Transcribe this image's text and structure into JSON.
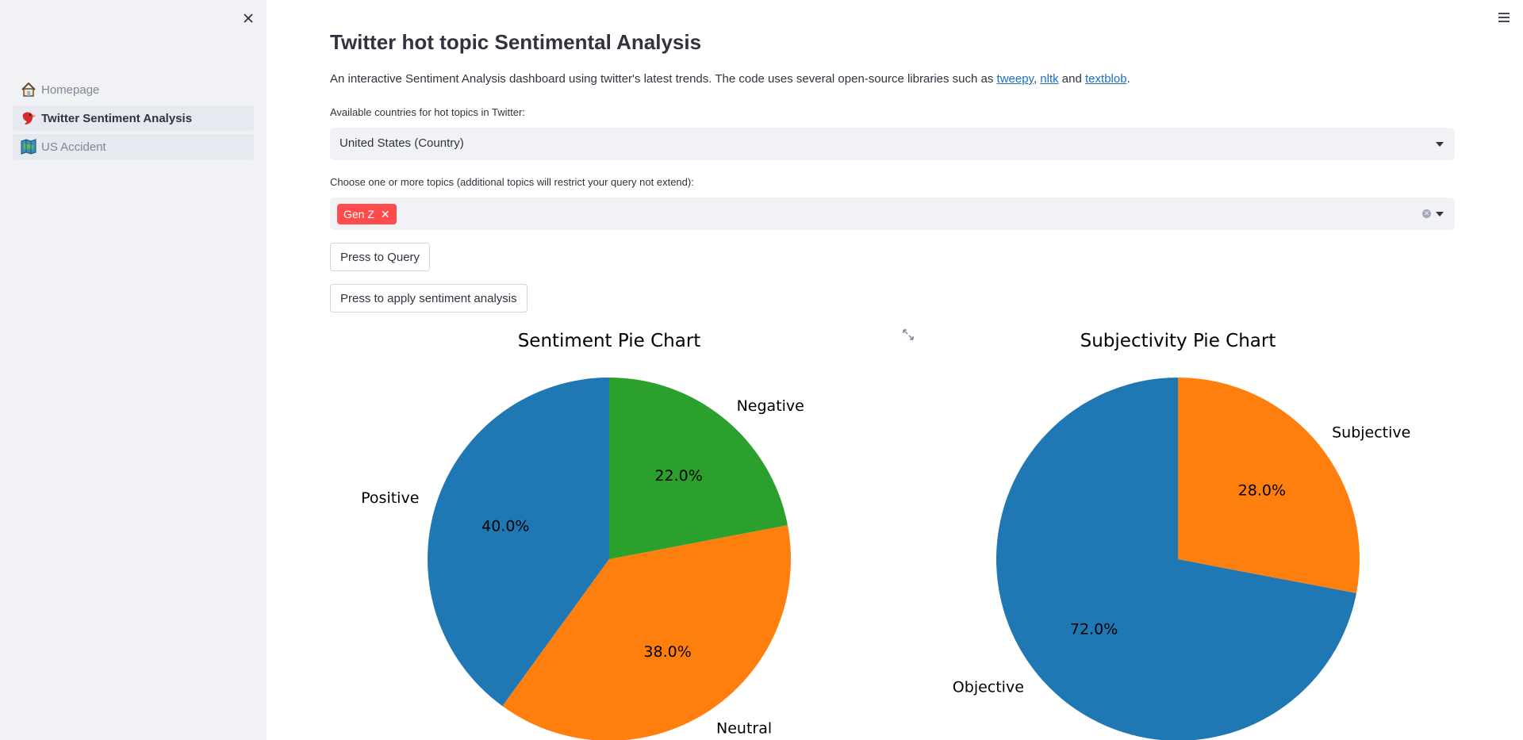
{
  "sidebar": {
    "items": [
      {
        "label": "Homepage",
        "icon": "house-icon",
        "active": false
      },
      {
        "label": "Twitter Sentiment Analysis",
        "icon": "bird-icon",
        "active": true
      },
      {
        "label": "US Accident",
        "icon": "map-icon",
        "active": false
      }
    ]
  },
  "main": {
    "title": "Twitter hot topic Sentimental Analysis",
    "intro_before": "An interactive Sentiment Analysis dashboard using twitter's latest trends. The code uses several open-source libraries such as ",
    "link_tweepy": "tweepy",
    "sep1": ", ",
    "link_nltk": "nltk",
    "sep2": " and ",
    "link_textblob": "textblob",
    "intro_end": ".",
    "country_label": "Available countries for hot topics in Twitter:",
    "country_value": "United States (Country)",
    "topics_label": "Choose one or more topics (additional topics will restrict your query not extend):",
    "topics_selected": [
      "Gen Z"
    ],
    "query_button": "Press to Query",
    "sentiment_button": "Press to apply sentiment analysis"
  },
  "colors": {
    "accent": "#ff4b4b",
    "blue": "#1f77b4",
    "orange": "#ff7f0e",
    "green": "#2ca02c"
  },
  "chart_data": [
    {
      "type": "pie",
      "title": "Sentiment Pie Chart",
      "labels": [
        "Positive",
        "Neutral",
        "Negative"
      ],
      "values": [
        40.0,
        38.0,
        22.0
      ],
      "value_labels": [
        "40.0%",
        "38.0%",
        "22.0%"
      ],
      "colors": [
        "#1f77b4",
        "#ff7f0e",
        "#2ca02c"
      ],
      "start_angle": 90,
      "direction": "counterclockwise"
    },
    {
      "type": "pie",
      "title": "Subjectivity Pie Chart",
      "labels": [
        "Objective",
        "Subjective"
      ],
      "values": [
        72.0,
        28.0
      ],
      "value_labels": [
        "72.0%",
        "28.0%"
      ],
      "colors": [
        "#1f77b4",
        "#ff7f0e"
      ],
      "start_angle": 90,
      "direction": "counterclockwise"
    }
  ]
}
